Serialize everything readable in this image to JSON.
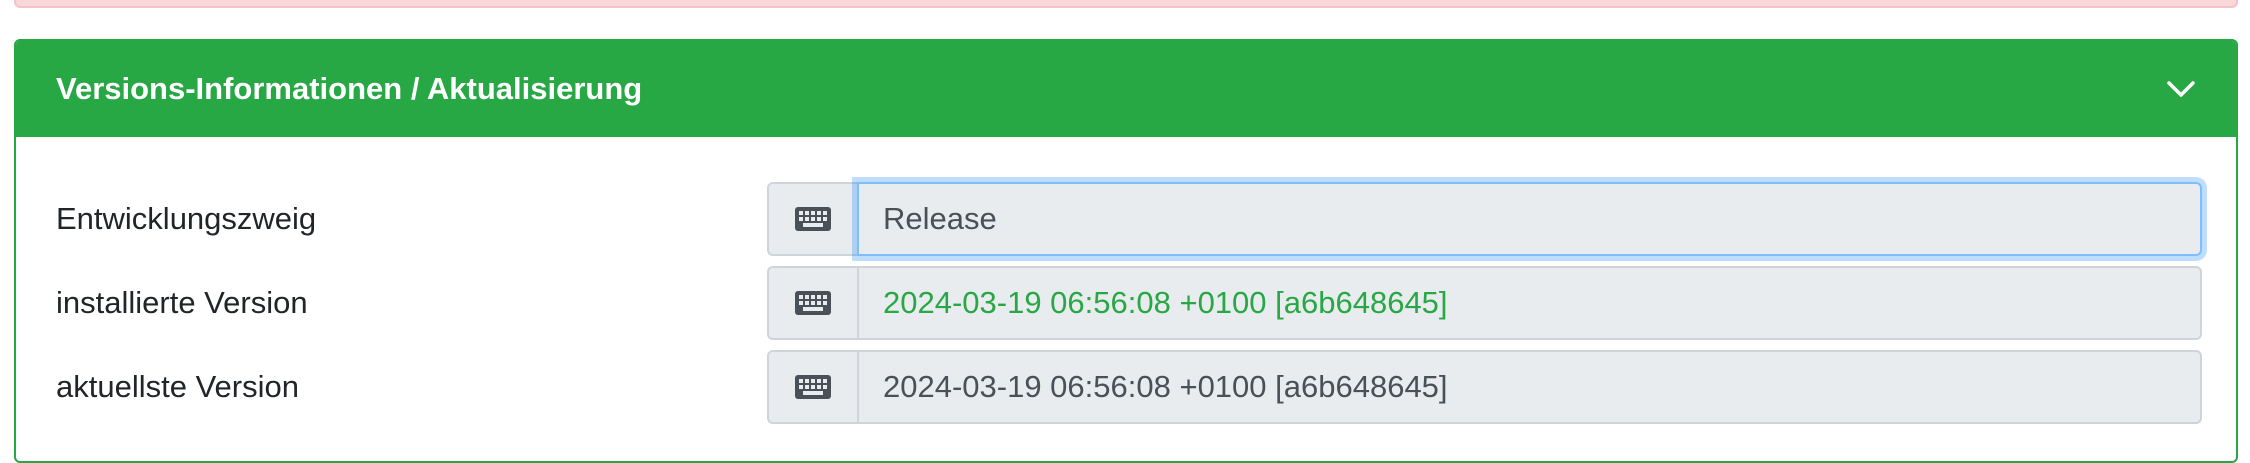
{
  "panel": {
    "title": "Versions-Informationen / Aktualisierung",
    "toggle_icon": "chevron-down-icon"
  },
  "rows": [
    {
      "label": "Entwicklungszweig",
      "value": "Release",
      "icon": "keyboard-icon"
    },
    {
      "label": "installierte Version",
      "value": "2024-03-19 06:56:08 +0100 [a6b648645]",
      "icon": "keyboard-icon"
    },
    {
      "label": "aktuellste Version",
      "value": "2024-03-19 06:56:08 +0100 [a6b648645]",
      "icon": "keyboard-icon"
    }
  ],
  "colors": {
    "header_bg": "#28a745",
    "installed_version_text": "#28a745",
    "alert_bg": "#f8d7da"
  }
}
